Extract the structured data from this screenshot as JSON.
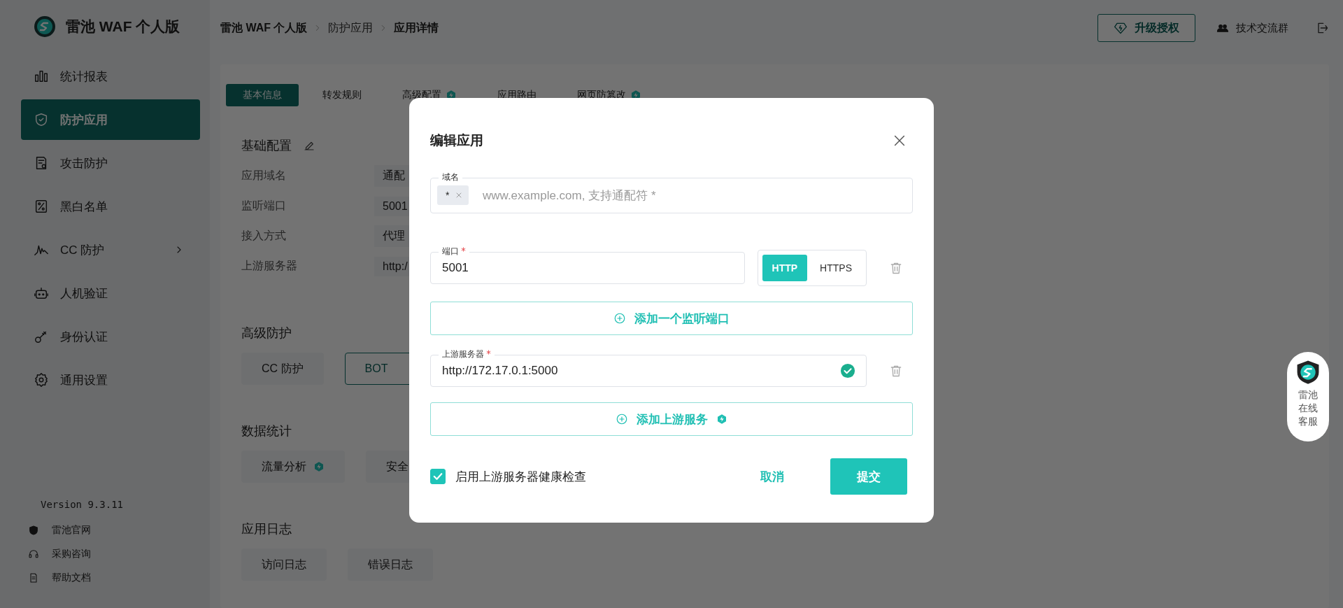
{
  "sidebar": {
    "brand": "雷池 WAF 个人版",
    "items": [
      {
        "label": "统计报表",
        "selected": false,
        "has_submenu": false
      },
      {
        "label": "防护应用",
        "selected": true,
        "has_submenu": false
      },
      {
        "label": "攻击防护",
        "selected": false,
        "has_submenu": false
      },
      {
        "label": "黑白名单",
        "selected": false,
        "has_submenu": false
      },
      {
        "label": "CC 防护",
        "selected": false,
        "has_submenu": true
      },
      {
        "label": "人机验证",
        "selected": false,
        "has_submenu": false
      },
      {
        "label": "身份认证",
        "selected": false,
        "has_submenu": false
      },
      {
        "label": "通用设置",
        "selected": false,
        "has_submenu": false
      }
    ],
    "version": "Version 9.3.11",
    "links": [
      "雷池官网",
      "采购咨询",
      "帮助文档"
    ]
  },
  "header": {
    "breadcrumb": [
      "雷池 WAF 个人版",
      "防护应用",
      "应用详情"
    ],
    "upgrade_button": "升级授权",
    "community_link": "技术交流群"
  },
  "tabs": [
    {
      "label": "基本信息",
      "selected": true,
      "pro": false
    },
    {
      "label": "转发规则",
      "selected": false,
      "pro": false
    },
    {
      "label": "高级配置",
      "selected": false,
      "pro": true
    },
    {
      "label": "应用路由",
      "selected": false,
      "pro": false
    },
    {
      "label": "网页防篡改",
      "selected": false,
      "pro": true
    }
  ],
  "sections": [
    {
      "title": "基础配置",
      "editable": true,
      "fields": [
        {
          "label": "应用域名",
          "value": "通配"
        },
        {
          "label": "监听端口",
          "value": "5001"
        },
        {
          "label": "接入方式",
          "value": "代理"
        },
        {
          "label": "上游服务器",
          "value": "http:/"
        }
      ]
    },
    {
      "title": "高级防护",
      "buttons": [
        {
          "label": "CC 防护",
          "selected": false,
          "pro": false
        },
        {
          "label": "BOT",
          "selected": true,
          "pro": false
        }
      ]
    },
    {
      "title": "数据统计",
      "buttons": [
        {
          "label": "流量分析",
          "selected": false,
          "pro": true
        },
        {
          "label": "安全",
          "selected": false,
          "pro": false
        }
      ]
    },
    {
      "title": "应用日志",
      "buttons": [
        {
          "label": "访问日志",
          "selected": false,
          "pro": false
        },
        {
          "label": "错误日志",
          "selected": false,
          "pro": false
        }
      ]
    }
  ],
  "modal": {
    "title": "编辑应用",
    "domain": {
      "label": "域名",
      "tags": [
        "*"
      ],
      "placeholder": "www.example.com, 支持通配符 *"
    },
    "port": {
      "label": "端口",
      "required": true,
      "value": "5001",
      "protocols": [
        {
          "label": "HTTP",
          "selected": true
        },
        {
          "label": "HTTPS",
          "selected": false
        }
      ]
    },
    "add_port": {
      "label": "添加一个监听端口"
    },
    "upstream": {
      "label": "上游服务器",
      "required": true,
      "value": "http://172.17.0.1:5000",
      "valid": true
    },
    "add_upstream": {
      "label": "添加上游服务",
      "pro": true
    },
    "health_check": {
      "label": "启用上游服务器健康检查",
      "checked": true
    },
    "cancel": "取消",
    "submit": "提交"
  },
  "support_widget": {
    "label": "雷池在线客服"
  }
}
